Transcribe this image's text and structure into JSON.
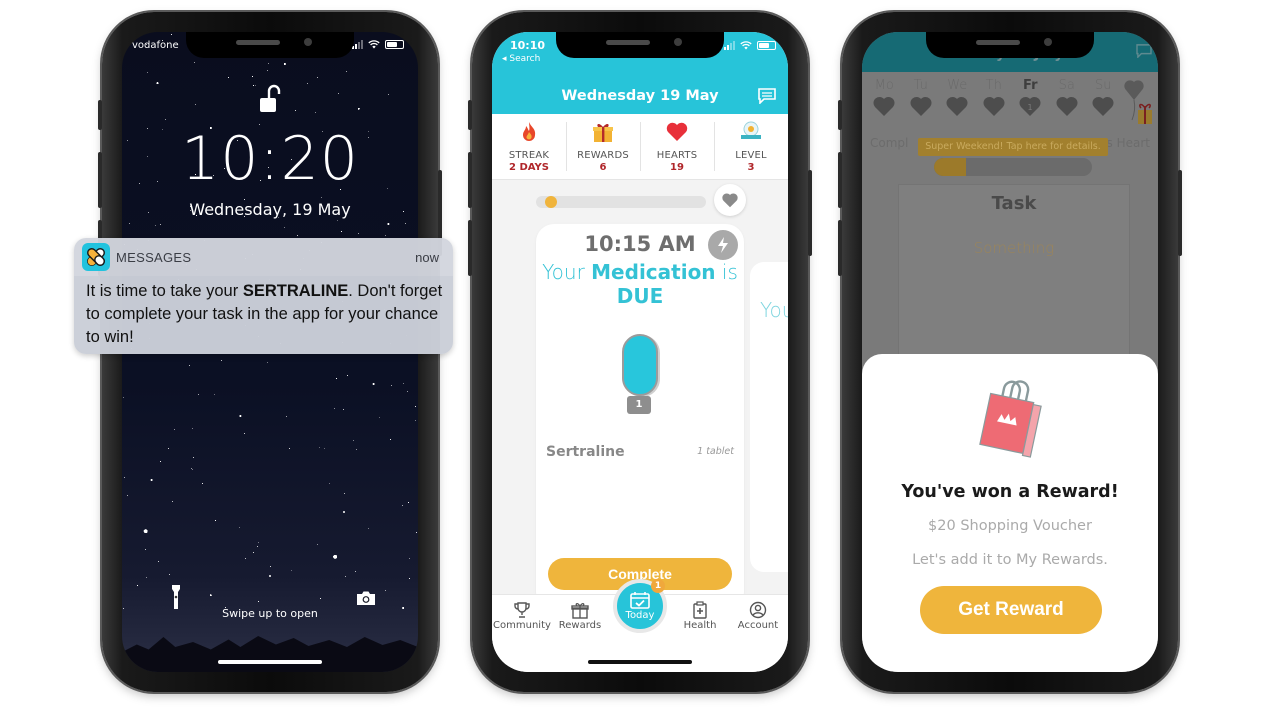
{
  "lock_screen": {
    "carrier": "vodafone",
    "time": "10:20",
    "date": "Wednesday, 19 May",
    "swipe_hint": "Swipe up to open",
    "icons": {
      "lock": "unlocked-padlock-icon",
      "flashlight": "flashlight-icon",
      "camera": "camera-icon"
    }
  },
  "notification": {
    "app_name": "MESSAGES",
    "time": "now",
    "body_prefix": "It is time to take your ",
    "body_bold": "SERTRALINE",
    "body_suffix": ". Don't forget to complete your task in the app for your chance to win!",
    "app_icon": "pills-bandage-icon"
  },
  "app_screen": {
    "status_time": "10:10",
    "back_label": "◂ Search",
    "title": "Wednesday 19 May",
    "stats": [
      {
        "label": "STREAK",
        "value": "2 DAYS",
        "icon": "flame-icon"
      },
      {
        "label": "REWARDS",
        "value": "6",
        "icon": "gift-icon"
      },
      {
        "label": "HEARTS",
        "value": "19",
        "icon": "heart-icon"
      },
      {
        "label": "LEVEL",
        "value": "3",
        "icon": "level-badge-icon"
      }
    ],
    "progress_fraction": 0.05,
    "task_card": {
      "time": "10:15 AM",
      "headline_part1": "Your ",
      "headline_strong": "Medication",
      "headline_part2": " is",
      "headline_line2": "DUE",
      "pill_count": "1",
      "medication": "Sertraline",
      "dose": "1 tablet",
      "complete_label": "Complete"
    },
    "next_card_peek": "You",
    "tabs": [
      {
        "label": "Community",
        "icon": "trophy-icon"
      },
      {
        "label": "Rewards",
        "icon": "gift-icon"
      },
      {
        "label": "Today",
        "icon": "calendar-check-icon",
        "badge": "1"
      },
      {
        "label": "Health",
        "icon": "clipboard-plus-icon"
      },
      {
        "label": "Account",
        "icon": "user-circle-icon"
      }
    ],
    "colors": {
      "primary": "#27c4d9",
      "accent": "#efb53c",
      "stat_value": "#b0262a"
    }
  },
  "reward_screen": {
    "background": {
      "title": "Friday 12 July",
      "days": [
        "Mo",
        "Tu",
        "We",
        "Th",
        "Fr",
        "Sa",
        "Su"
      ],
      "today_index": 4,
      "today_heart_value": "1",
      "caption_left": "Compl",
      "caption_right": "s Heart",
      "tooltip": "Super Weekend! Tap here for details.",
      "progress_fraction": 0.2,
      "task_title": "Task",
      "task_sub": "Something"
    },
    "popup": {
      "title": "You've won a Reward!",
      "reward": "$20 Shopping Voucher",
      "message": "Let's add it to My Rewards.",
      "button_label": "Get Reward",
      "icon": "shopping-bag-crown-icon"
    }
  }
}
